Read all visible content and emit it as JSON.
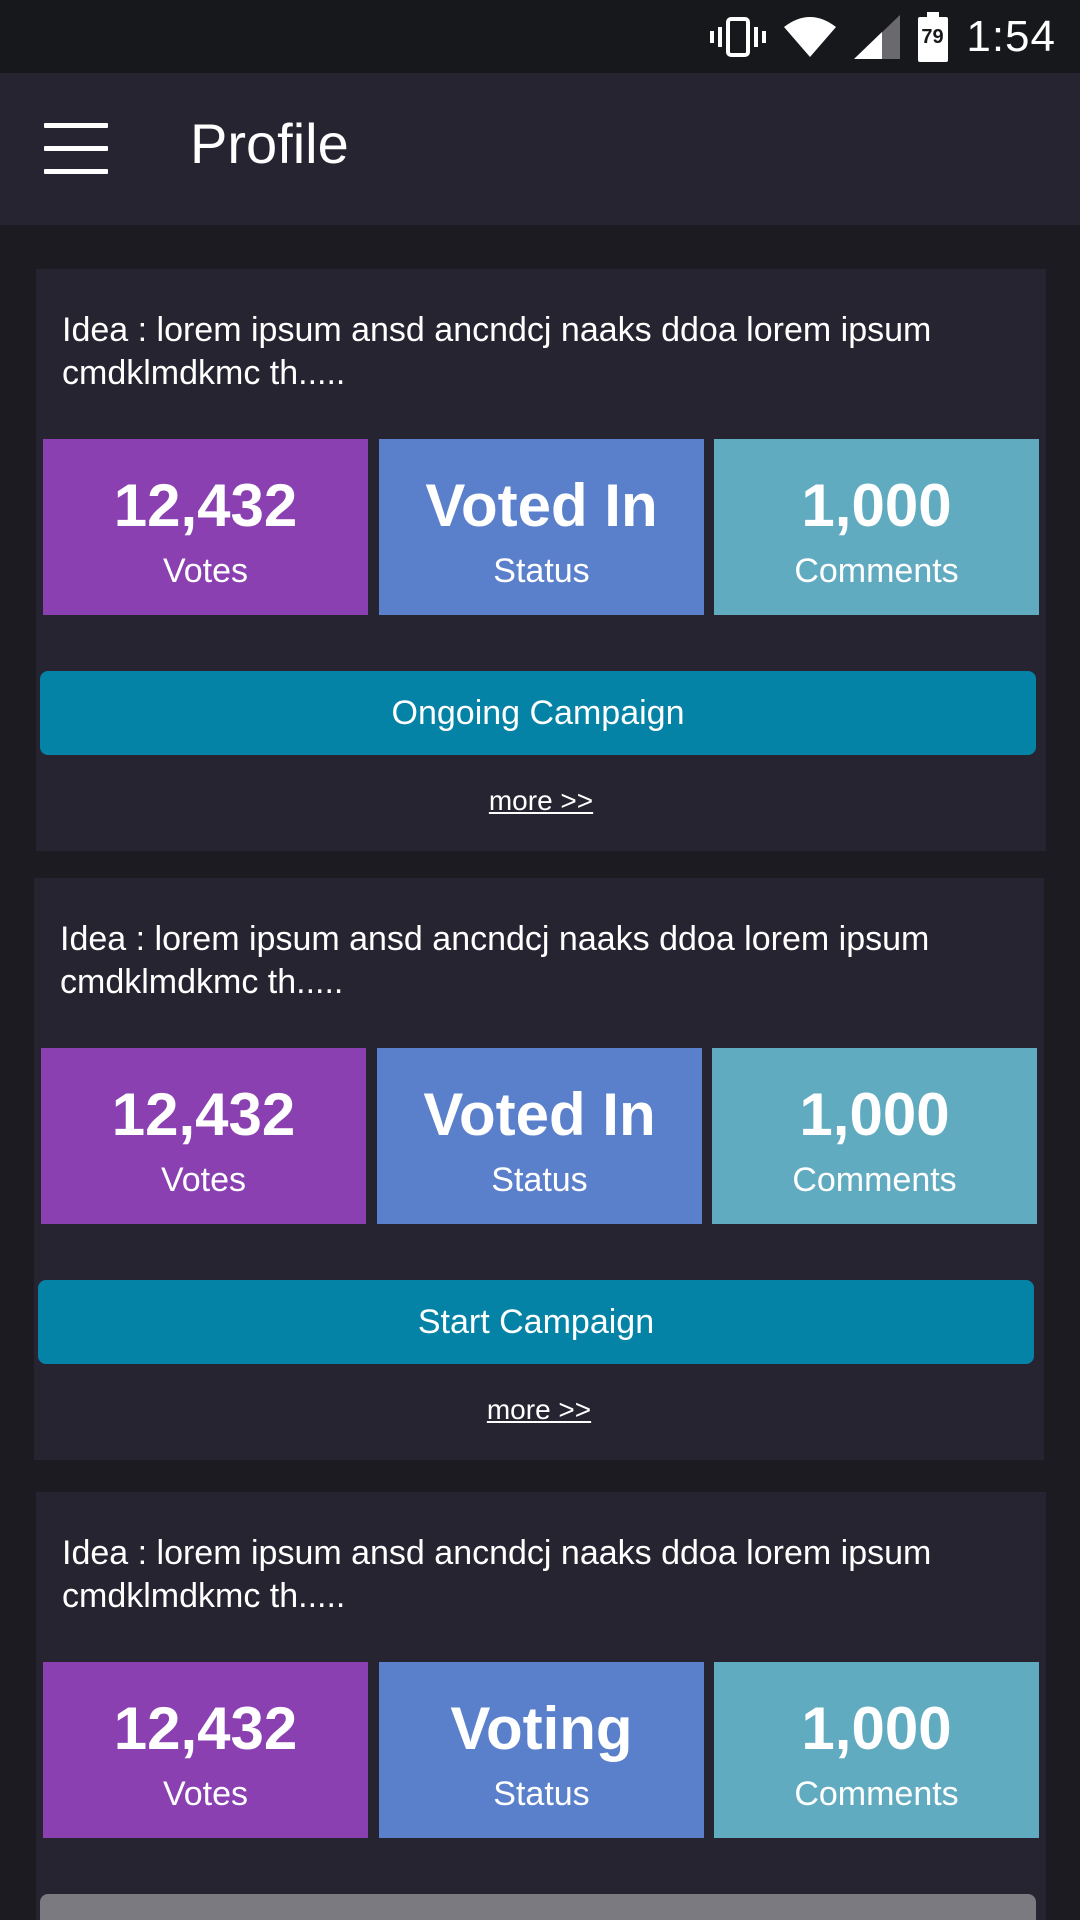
{
  "status_bar": {
    "time": "1:54",
    "battery_level": "79",
    "icons": [
      "vibrate-icon",
      "wifi-icon",
      "signal-icon",
      "battery-icon"
    ]
  },
  "app_bar": {
    "menu_icon": "hamburger-menu-icon",
    "title": "Profile"
  },
  "colors": {
    "votes_tile": "#8a40b1",
    "status_tile": "#5b80cb",
    "comments_tile": "#61abc1",
    "campaign_button": "#0583a6",
    "card_background": "#262431"
  },
  "cards": [
    {
      "idea": "Idea : lorem ipsum ansd ancndcj naaks ddoa lorem ipsum cmdklmdkmc th.....",
      "votes_value": "12,432",
      "votes_label": "Votes",
      "status_value": "Voted In",
      "status_label": "Status",
      "comments_value": "1,000",
      "comments_label": "Comments",
      "button_label": "Ongoing Campaign",
      "more_label": "more >>"
    },
    {
      "idea": "Idea : lorem ipsum ansd ancndcj naaks ddoa lorem ipsum cmdklmdkmc th.....",
      "votes_value": "12,432",
      "votes_label": "Votes",
      "status_value": "Voted In",
      "status_label": "Status",
      "comments_value": "1,000",
      "comments_label": "Comments",
      "button_label": "Start Campaign",
      "more_label": "more >>"
    },
    {
      "idea": "Idea : lorem ipsum ansd ancndcj naaks ddoa lorem ipsum cmdklmdkmc th.....",
      "votes_value": "12,432",
      "votes_label": "Votes",
      "status_value": "Voting",
      "status_label": "Status",
      "comments_value": "1,000",
      "comments_label": "Comments",
      "button_label": "",
      "more_label": ""
    }
  ]
}
